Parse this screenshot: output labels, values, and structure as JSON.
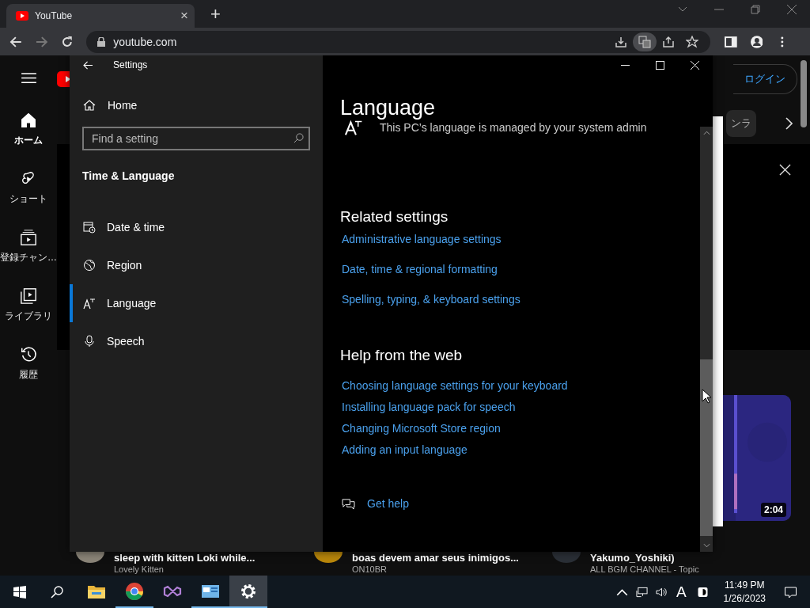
{
  "browser": {
    "tab": {
      "title": "YouTube",
      "close": "×"
    },
    "new_tab": "+",
    "address": "youtube.com"
  },
  "youtube": {
    "sidebar": [
      {
        "label": "ホーム",
        "kind": "home",
        "selected": true
      },
      {
        "label": "ショート",
        "kind": "shorts",
        "selected": false
      },
      {
        "label": "登録チャン…",
        "kind": "subs",
        "selected": false
      },
      {
        "label": "ライブラリ",
        "kind": "library",
        "selected": false
      },
      {
        "label": "履歴",
        "kind": "history",
        "selected": false
      }
    ],
    "login": "ログイン",
    "chip": "ンラ",
    "duration": "2:04",
    "videos": [
      {
        "title": "sleep with kitten Loki while...",
        "channel": "Lovely Kitten",
        "color": "#8a8478"
      },
      {
        "title": "boas devem amar seus inimigos...",
        "channel": "ON10BR",
        "color": "#b8860b"
      },
      {
        "title": "Yakumo_Yoshiki)",
        "channel": "ALL BGM CHANNEL - Topic",
        "color": "#2a2f36"
      }
    ]
  },
  "settings": {
    "title": "Settings",
    "home": "Home",
    "search": {
      "placeholder": "Find a setting"
    },
    "section": "Time & Language",
    "items": [
      {
        "label": "Date & time",
        "kind": "datetime",
        "selected": false
      },
      {
        "label": "Region",
        "kind": "region",
        "selected": false
      },
      {
        "label": "Language",
        "kind": "language",
        "selected": true
      },
      {
        "label": "Speech",
        "kind": "speech",
        "selected": false
      }
    ],
    "page_title": "Language",
    "notice": "This PC’s language is managed by your system admin",
    "related": {
      "heading": "Related settings",
      "links": [
        "Administrative language settings",
        "Date, time & regional formatting",
        "Spelling, typing, & keyboard settings"
      ]
    },
    "help": {
      "heading": "Help from the web",
      "links": [
        "Choosing language settings for your keyboard",
        "Installing language pack for speech",
        "Changing Microsoft Store region",
        "Adding an input language"
      ]
    },
    "get_help": "Get help"
  },
  "taskbar": {
    "apps": [
      {
        "kind": "explorer",
        "running": false,
        "selected": false
      },
      {
        "kind": "chrome",
        "running": true,
        "selected": false
      },
      {
        "kind": "vs",
        "running": false,
        "selected": false
      },
      {
        "kind": "panel",
        "running": true,
        "selected": false
      },
      {
        "kind": "settings",
        "running": true,
        "selected": true
      }
    ],
    "ime": "A",
    "time": "11:49 PM",
    "date": "1/26/2023"
  }
}
